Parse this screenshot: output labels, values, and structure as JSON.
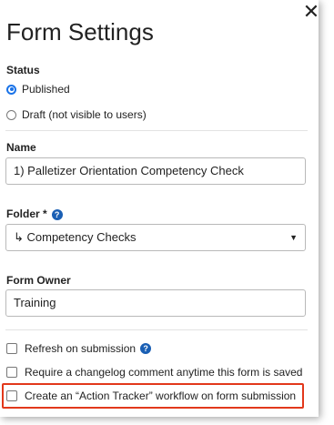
{
  "panel": {
    "title": "Form Settings",
    "close_glyph": "✕"
  },
  "status": {
    "label": "Status",
    "options": [
      {
        "label": "Published",
        "selected": true
      },
      {
        "label": "Draft (not visible to users)",
        "selected": false
      }
    ]
  },
  "name": {
    "label": "Name",
    "value": "1) Palletizer Orientation Competency Check"
  },
  "folder": {
    "label": "Folder *",
    "selected": "↳ Competency Checks",
    "caret": "▼"
  },
  "owner": {
    "label": "Form Owner",
    "value": "Training"
  },
  "options": [
    {
      "label": "Refresh on submission",
      "checked": false,
      "help": true
    },
    {
      "label": "Require a changelog comment anytime this form is saved",
      "checked": false,
      "help": false
    },
    {
      "label": "Create an “Action Tracker” workflow on form submission",
      "checked": false,
      "help": false,
      "highlighted": true
    }
  ],
  "help_glyph": "?",
  "colors": {
    "accent": "#1a73e8",
    "help_icon": "#1a5fb4",
    "highlight_border": "#e2381b",
    "field_border": "#b9b9b9"
  }
}
